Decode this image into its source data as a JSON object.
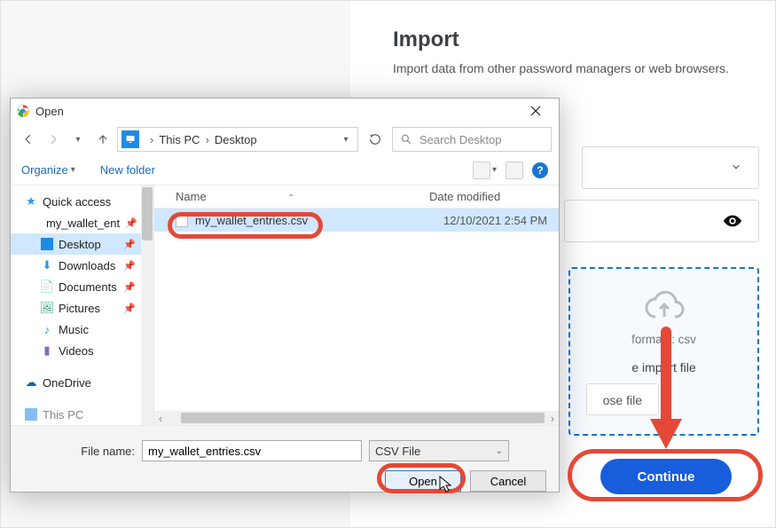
{
  "page": {
    "title": "Import",
    "subtitle": "Import data from other password managers or web browsers.",
    "dropzone": {
      "formats_label": "formats: csv",
      "import_file_label": "e import file",
      "choose_label": "ose file"
    },
    "continue_label": "Continue"
  },
  "dialog": {
    "title": "Open",
    "breadcrumb": {
      "root": "This PC",
      "leaf": "Desktop"
    },
    "search_placeholder": "Search Desktop",
    "toolbar": {
      "organize": "Organize",
      "new_folder": "New folder"
    },
    "tree": {
      "quick_access": "Quick access",
      "items": [
        {
          "label": "my_wallet_ent",
          "type": "folder"
        },
        {
          "label": "Desktop",
          "type": "blue-folder",
          "selected": true
        },
        {
          "label": "Downloads",
          "type": "download"
        },
        {
          "label": "Documents",
          "type": "doc"
        },
        {
          "label": "Pictures",
          "type": "pic"
        },
        {
          "label": "Music",
          "type": "music"
        },
        {
          "label": "Videos",
          "type": "video"
        }
      ],
      "onedrive": "OneDrive",
      "thispc": "This PC"
    },
    "columns": {
      "name": "Name",
      "date": "Date modified"
    },
    "selected_file": {
      "name": "my_wallet_entries.csv",
      "date": "12/10/2021 2:54 PM"
    },
    "footer": {
      "filename_label": "File name:",
      "filename_value": "my_wallet_entries.csv",
      "filter": "CSV File",
      "open": "Open",
      "cancel": "Cancel"
    }
  }
}
